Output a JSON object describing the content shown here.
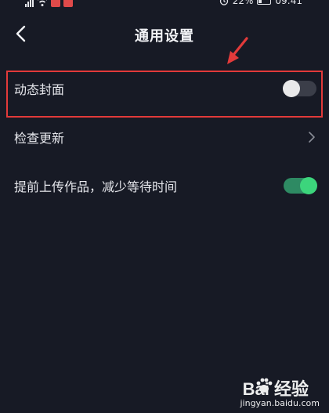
{
  "status_bar": {
    "battery": "22%",
    "time": "09:41"
  },
  "header": {
    "title": "通用设置",
    "back_icon": "chevron-left-icon"
  },
  "settings": [
    {
      "label": "动态封面",
      "control": "toggle",
      "state": "off"
    },
    {
      "label": "检查更新",
      "control": "chevron"
    },
    {
      "label": "提前上传作品，减少等待时间",
      "control": "toggle",
      "state": "on"
    }
  ],
  "annotation": {
    "color": "#e23a3a",
    "highlighted_item": "动态封面"
  },
  "watermark": {
    "brand": "Bai  经验",
    "url": "jingyan.baidu.com"
  },
  "colors": {
    "background": "#171a25",
    "toggle_on": "#3cd57c",
    "toggle_off_track": "#3b3e49"
  }
}
